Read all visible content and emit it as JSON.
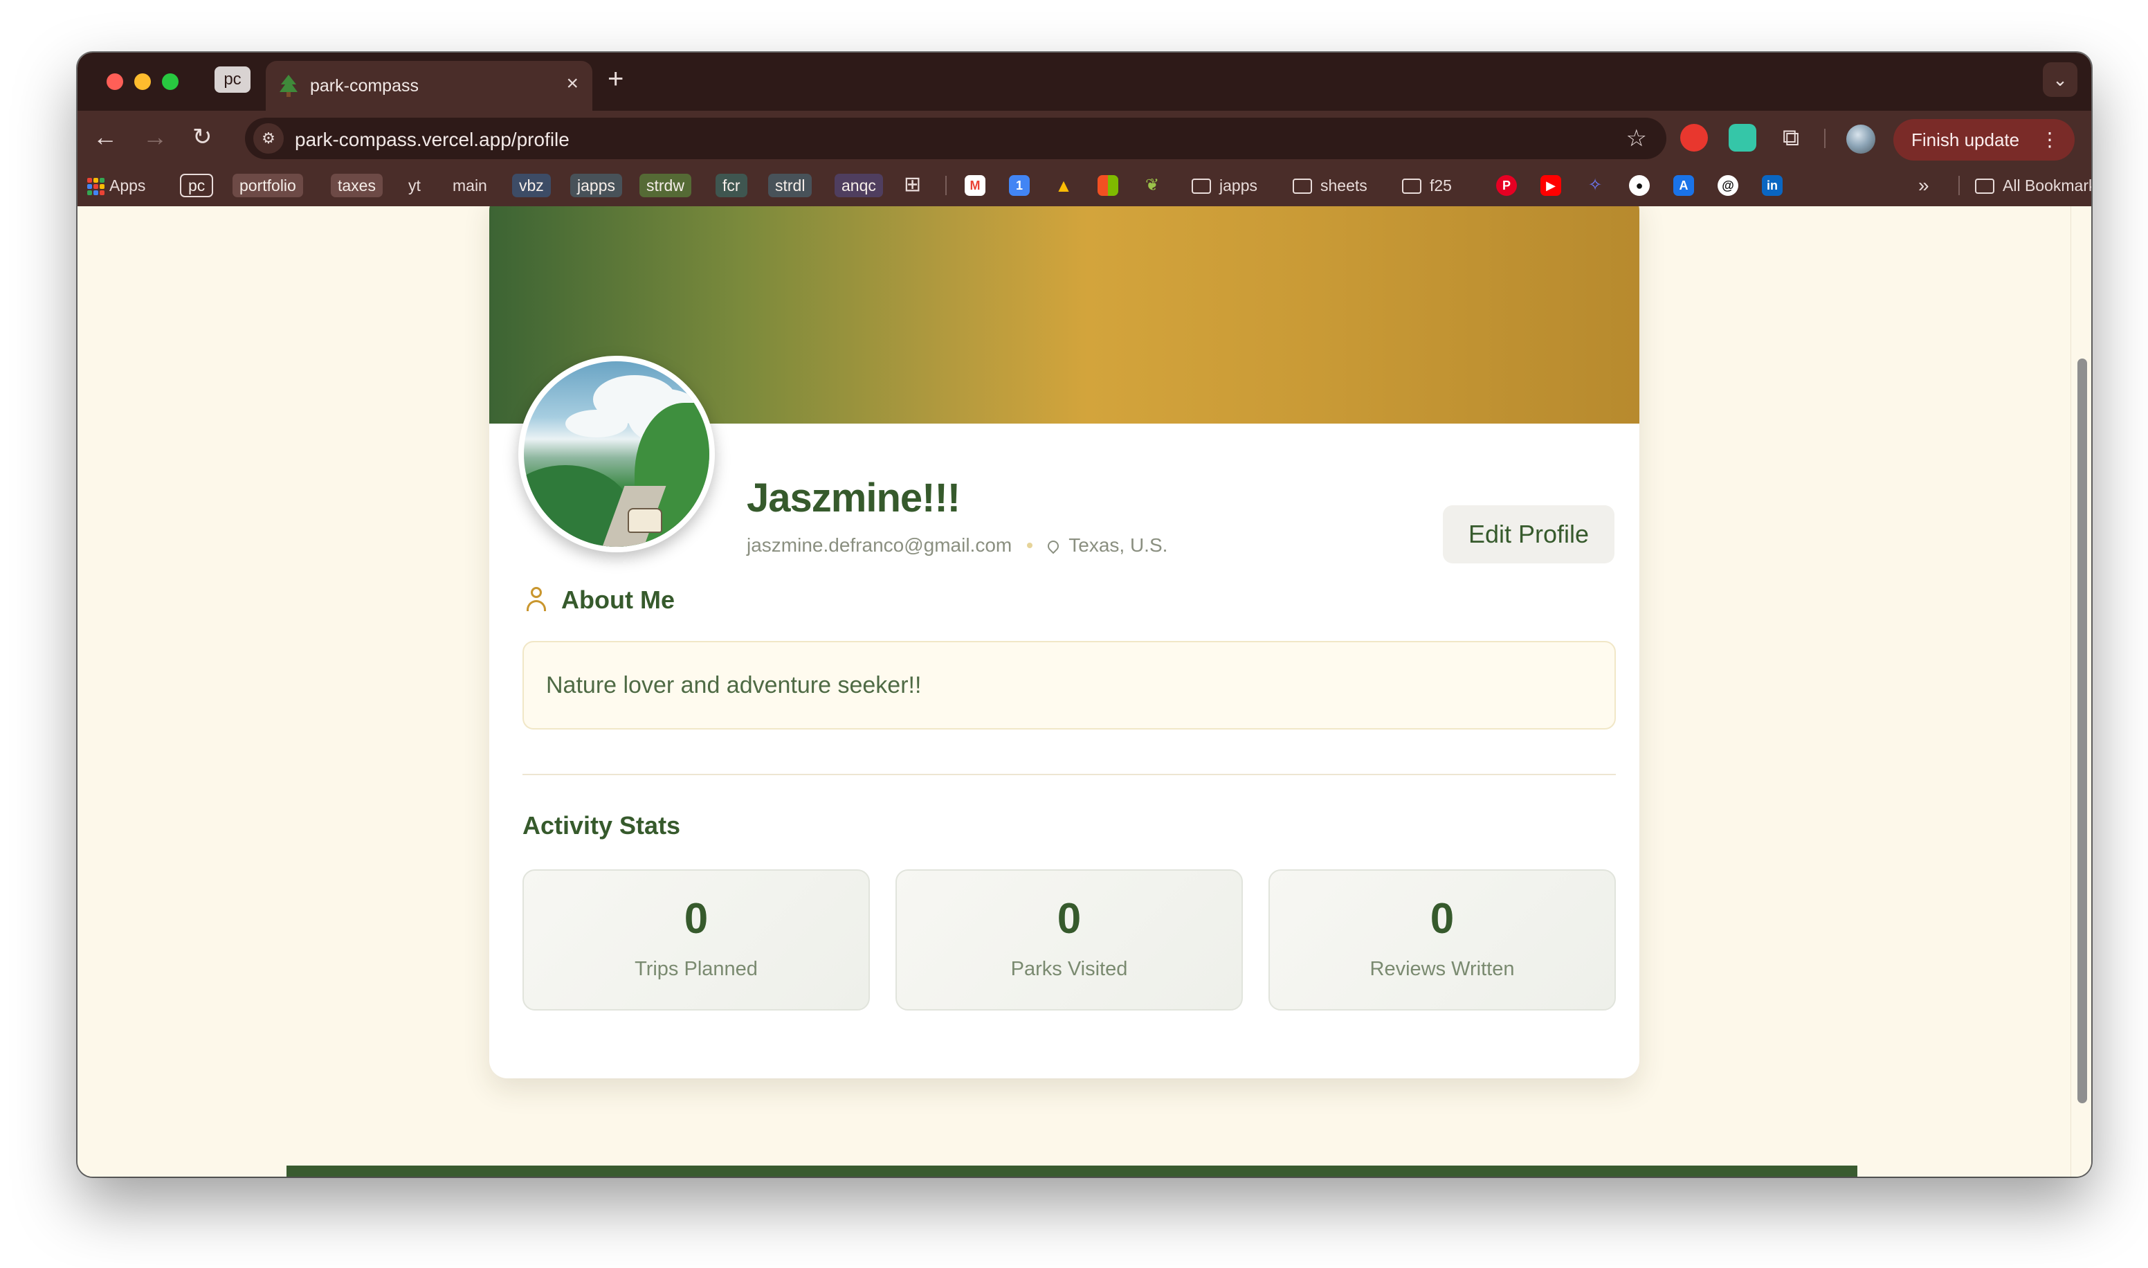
{
  "browser": {
    "pinned_tab": "pc",
    "active_tab": {
      "title": "park-compass",
      "favicon": "tree-icon"
    },
    "url": "park-compass.vercel.app/profile",
    "finish_update": "Finish update",
    "bookmarks": {
      "apps": "Apps",
      "chips": [
        "pc",
        "portfolio",
        "taxes",
        "yt",
        "main",
        "vbz",
        "japps",
        "strdw",
        "fcr",
        "strdl",
        "anqc"
      ],
      "folders": [
        "japps",
        "sheets",
        "f25"
      ],
      "all_bookmarks": "All Bookmarks",
      "overflow": "»"
    }
  },
  "profile": {
    "name": "Jaszmine!!!",
    "email": "jaszmine.defranco@gmail.com",
    "location": "Texas, U.S.",
    "edit_button": "Edit Profile",
    "about_title": "About Me",
    "about_text": "Nature lover and adventure seeker!!",
    "stats_title": "Activity Stats",
    "stats": [
      {
        "value": "0",
        "label": "Trips Planned"
      },
      {
        "value": "0",
        "label": "Parks Visited"
      },
      {
        "value": "0",
        "label": "Reviews Written"
      }
    ]
  },
  "colors": {
    "brand_green": "#365a2c",
    "accent_gold": "#c9962e",
    "page_bg": "#fdf8ea"
  }
}
